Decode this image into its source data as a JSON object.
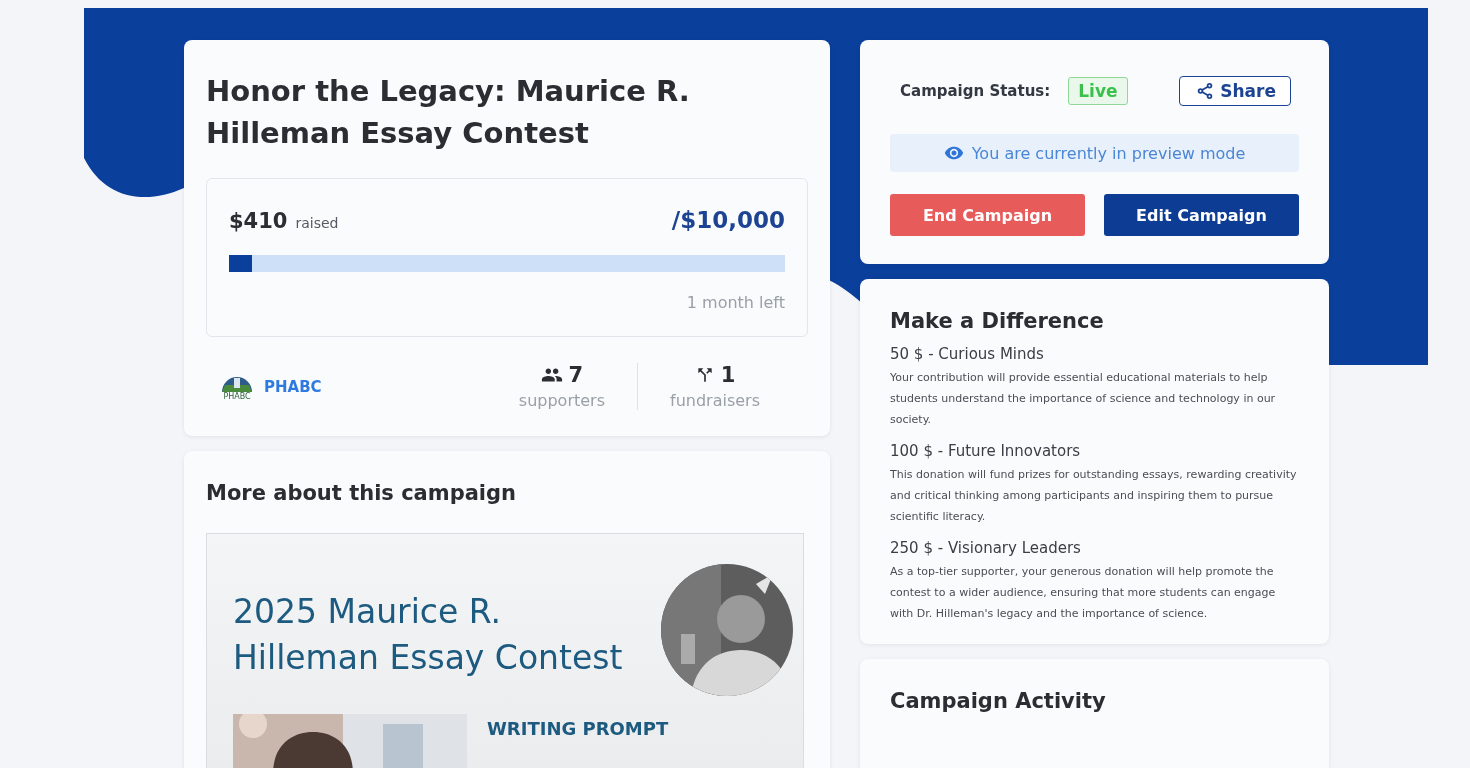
{
  "campaign": {
    "title": "Honor the Legacy: Maurice R. Hilleman Essay Contest",
    "raised": "$410",
    "raised_label": "raised",
    "goal": "/$10,000",
    "level": 0.041,
    "time_left": "1 month left",
    "organizer": {
      "logo_text": "PHABC",
      "name": "PHABC"
    },
    "stats": [
      {
        "kind": "supporters",
        "value": "7",
        "label": "supporters"
      },
      {
        "kind": "fundraisers",
        "value": "1",
        "label": "fundraisers"
      }
    ]
  },
  "about": {
    "heading": "More about this campaign",
    "poster": {
      "title_lines": [
        "2025 Maurice R.",
        "Hilleman Essay Contest"
      ],
      "section_label": "WRITING PROMPT"
    }
  },
  "status_card": {
    "status_label": "Campaign Status:",
    "status": "Live",
    "share": "Share",
    "preview_notice": "You are currently in preview mode",
    "buttons": [
      {
        "label": "End Campaign",
        "kind": "danger"
      },
      {
        "label": "Edit Campaign",
        "kind": "primary"
      }
    ]
  },
  "tiers": {
    "heading": "Make a Difference",
    "items": [
      {
        "title": "50 $ - Curious Minds",
        "description": "Your contribution will provide essential educational materials to help students understand the importance of science and technology in our society."
      },
      {
        "title": "100 $ - Future Innovators",
        "description": "This donation will fund prizes for outstanding essays, rewarding creativity and critical thinking among participants and inspiring them to pursue scientific literacy."
      },
      {
        "title": "250 $ - Visionary Leaders",
        "description": "As a top-tier supporter, your generous donation will help promote the contest to a wider audience, ensuring that more students can engage with Dr. Hilleman's legacy and the importance of science."
      }
    ]
  },
  "activity": {
    "heading": "Campaign Activity"
  }
}
